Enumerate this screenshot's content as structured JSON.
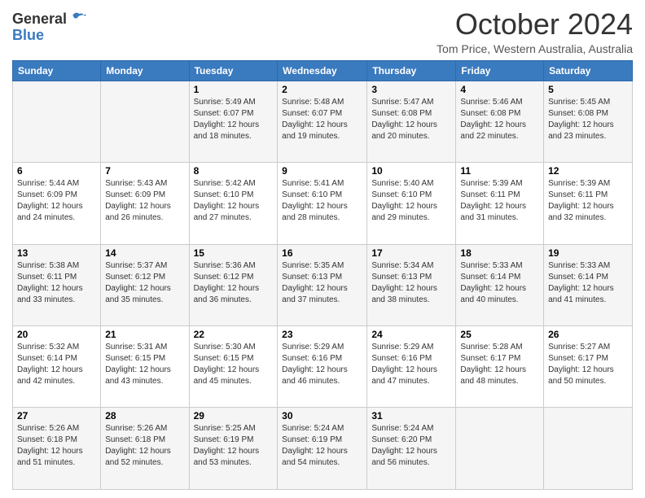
{
  "logo": {
    "general": "General",
    "blue": "Blue"
  },
  "header": {
    "month": "October 2024",
    "location": "Tom Price, Western Australia, Australia"
  },
  "days_of_week": [
    "Sunday",
    "Monday",
    "Tuesday",
    "Wednesday",
    "Thursday",
    "Friday",
    "Saturday"
  ],
  "weeks": [
    [
      {
        "day": "",
        "sunrise": "",
        "sunset": "",
        "daylight": ""
      },
      {
        "day": "",
        "sunrise": "",
        "sunset": "",
        "daylight": ""
      },
      {
        "day": "1",
        "sunrise": "Sunrise: 5:49 AM",
        "sunset": "Sunset: 6:07 PM",
        "daylight": "Daylight: 12 hours and 18 minutes."
      },
      {
        "day": "2",
        "sunrise": "Sunrise: 5:48 AM",
        "sunset": "Sunset: 6:07 PM",
        "daylight": "Daylight: 12 hours and 19 minutes."
      },
      {
        "day": "3",
        "sunrise": "Sunrise: 5:47 AM",
        "sunset": "Sunset: 6:08 PM",
        "daylight": "Daylight: 12 hours and 20 minutes."
      },
      {
        "day": "4",
        "sunrise": "Sunrise: 5:46 AM",
        "sunset": "Sunset: 6:08 PM",
        "daylight": "Daylight: 12 hours and 22 minutes."
      },
      {
        "day": "5",
        "sunrise": "Sunrise: 5:45 AM",
        "sunset": "Sunset: 6:08 PM",
        "daylight": "Daylight: 12 hours and 23 minutes."
      }
    ],
    [
      {
        "day": "6",
        "sunrise": "Sunrise: 5:44 AM",
        "sunset": "Sunset: 6:09 PM",
        "daylight": "Daylight: 12 hours and 24 minutes."
      },
      {
        "day": "7",
        "sunrise": "Sunrise: 5:43 AM",
        "sunset": "Sunset: 6:09 PM",
        "daylight": "Daylight: 12 hours and 26 minutes."
      },
      {
        "day": "8",
        "sunrise": "Sunrise: 5:42 AM",
        "sunset": "Sunset: 6:10 PM",
        "daylight": "Daylight: 12 hours and 27 minutes."
      },
      {
        "day": "9",
        "sunrise": "Sunrise: 5:41 AM",
        "sunset": "Sunset: 6:10 PM",
        "daylight": "Daylight: 12 hours and 28 minutes."
      },
      {
        "day": "10",
        "sunrise": "Sunrise: 5:40 AM",
        "sunset": "Sunset: 6:10 PM",
        "daylight": "Daylight: 12 hours and 29 minutes."
      },
      {
        "day": "11",
        "sunrise": "Sunrise: 5:39 AM",
        "sunset": "Sunset: 6:11 PM",
        "daylight": "Daylight: 12 hours and 31 minutes."
      },
      {
        "day": "12",
        "sunrise": "Sunrise: 5:39 AM",
        "sunset": "Sunset: 6:11 PM",
        "daylight": "Daylight: 12 hours and 32 minutes."
      }
    ],
    [
      {
        "day": "13",
        "sunrise": "Sunrise: 5:38 AM",
        "sunset": "Sunset: 6:11 PM",
        "daylight": "Daylight: 12 hours and 33 minutes."
      },
      {
        "day": "14",
        "sunrise": "Sunrise: 5:37 AM",
        "sunset": "Sunset: 6:12 PM",
        "daylight": "Daylight: 12 hours and 35 minutes."
      },
      {
        "day": "15",
        "sunrise": "Sunrise: 5:36 AM",
        "sunset": "Sunset: 6:12 PM",
        "daylight": "Daylight: 12 hours and 36 minutes."
      },
      {
        "day": "16",
        "sunrise": "Sunrise: 5:35 AM",
        "sunset": "Sunset: 6:13 PM",
        "daylight": "Daylight: 12 hours and 37 minutes."
      },
      {
        "day": "17",
        "sunrise": "Sunrise: 5:34 AM",
        "sunset": "Sunset: 6:13 PM",
        "daylight": "Daylight: 12 hours and 38 minutes."
      },
      {
        "day": "18",
        "sunrise": "Sunrise: 5:33 AM",
        "sunset": "Sunset: 6:14 PM",
        "daylight": "Daylight: 12 hours and 40 minutes."
      },
      {
        "day": "19",
        "sunrise": "Sunrise: 5:33 AM",
        "sunset": "Sunset: 6:14 PM",
        "daylight": "Daylight: 12 hours and 41 minutes."
      }
    ],
    [
      {
        "day": "20",
        "sunrise": "Sunrise: 5:32 AM",
        "sunset": "Sunset: 6:14 PM",
        "daylight": "Daylight: 12 hours and 42 minutes."
      },
      {
        "day": "21",
        "sunrise": "Sunrise: 5:31 AM",
        "sunset": "Sunset: 6:15 PM",
        "daylight": "Daylight: 12 hours and 43 minutes."
      },
      {
        "day": "22",
        "sunrise": "Sunrise: 5:30 AM",
        "sunset": "Sunset: 6:15 PM",
        "daylight": "Daylight: 12 hours and 45 minutes."
      },
      {
        "day": "23",
        "sunrise": "Sunrise: 5:29 AM",
        "sunset": "Sunset: 6:16 PM",
        "daylight": "Daylight: 12 hours and 46 minutes."
      },
      {
        "day": "24",
        "sunrise": "Sunrise: 5:29 AM",
        "sunset": "Sunset: 6:16 PM",
        "daylight": "Daylight: 12 hours and 47 minutes."
      },
      {
        "day": "25",
        "sunrise": "Sunrise: 5:28 AM",
        "sunset": "Sunset: 6:17 PM",
        "daylight": "Daylight: 12 hours and 48 minutes."
      },
      {
        "day": "26",
        "sunrise": "Sunrise: 5:27 AM",
        "sunset": "Sunset: 6:17 PM",
        "daylight": "Daylight: 12 hours and 50 minutes."
      }
    ],
    [
      {
        "day": "27",
        "sunrise": "Sunrise: 5:26 AM",
        "sunset": "Sunset: 6:18 PM",
        "daylight": "Daylight: 12 hours and 51 minutes."
      },
      {
        "day": "28",
        "sunrise": "Sunrise: 5:26 AM",
        "sunset": "Sunset: 6:18 PM",
        "daylight": "Daylight: 12 hours and 52 minutes."
      },
      {
        "day": "29",
        "sunrise": "Sunrise: 5:25 AM",
        "sunset": "Sunset: 6:19 PM",
        "daylight": "Daylight: 12 hours and 53 minutes."
      },
      {
        "day": "30",
        "sunrise": "Sunrise: 5:24 AM",
        "sunset": "Sunset: 6:19 PM",
        "daylight": "Daylight: 12 hours and 54 minutes."
      },
      {
        "day": "31",
        "sunrise": "Sunrise: 5:24 AM",
        "sunset": "Sunset: 6:20 PM",
        "daylight": "Daylight: 12 hours and 56 minutes."
      },
      {
        "day": "",
        "sunrise": "",
        "sunset": "",
        "daylight": ""
      },
      {
        "day": "",
        "sunrise": "",
        "sunset": "",
        "daylight": ""
      }
    ]
  ]
}
